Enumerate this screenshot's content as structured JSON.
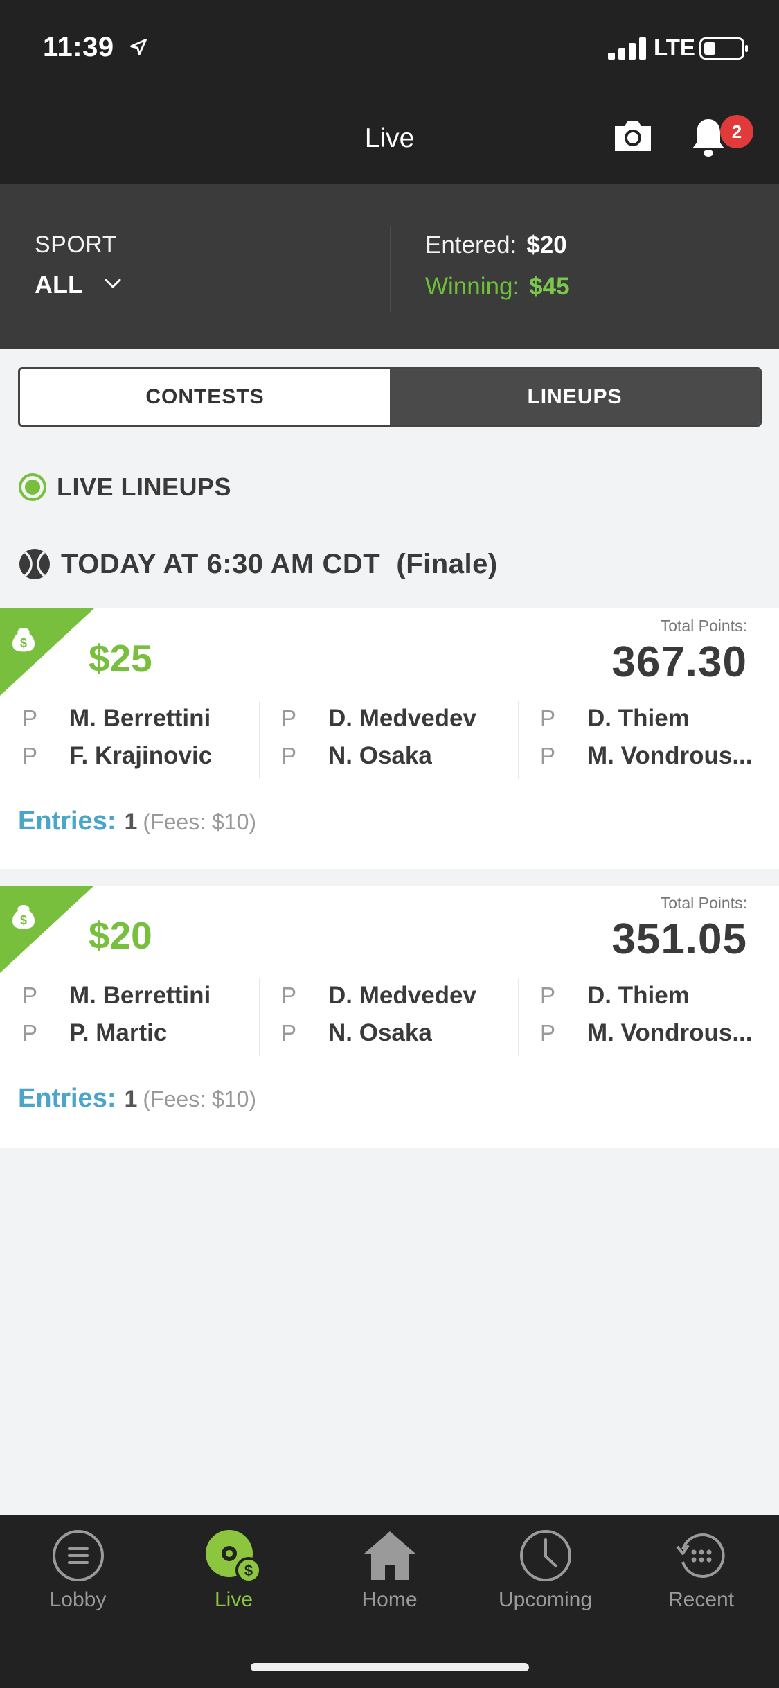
{
  "status_bar": {
    "time": "11:39",
    "network": "LTE",
    "signal_icon": "signal-bars-icon",
    "battery_icon": "battery-icon"
  },
  "nav": {
    "title": "Live",
    "notification_count": "2"
  },
  "summary": {
    "sport_label": "SPORT",
    "sport_value": "ALL",
    "entered_label": "Entered:",
    "entered_value": "$20",
    "winning_label": "Winning:",
    "winning_value": "$45"
  },
  "tabs": {
    "contests": "CONTESTS",
    "lineups": "LINEUPS",
    "selected": "LINEUPS"
  },
  "section": {
    "live_title": "LIVE LINEUPS",
    "date_title": "TODAY AT 6:30 AM CDT  (Finale)"
  },
  "lineups": [
    {
      "prize": "$25",
      "points_label": "Total Points:",
      "points": "367.30",
      "players": [
        [
          {
            "pos": "P",
            "name": "M. Berrettini"
          },
          {
            "pos": "P",
            "name": "F. Krajinovic"
          }
        ],
        [
          {
            "pos": "P",
            "name": "D. Medvedev"
          },
          {
            "pos": "P",
            "name": "N. Osaka"
          }
        ],
        [
          {
            "pos": "P",
            "name": "D. Thiem"
          },
          {
            "pos": "P",
            "name": "M. Vondrous..."
          }
        ]
      ],
      "entries_label": "Entries:",
      "entries_count": "1",
      "fees": "(Fees: $10)"
    },
    {
      "prize": "$20",
      "points_label": "Total Points:",
      "points": "351.05",
      "players": [
        [
          {
            "pos": "P",
            "name": "M. Berrettini"
          },
          {
            "pos": "P",
            "name": "P. Martic"
          }
        ],
        [
          {
            "pos": "P",
            "name": "D. Medvedev"
          },
          {
            "pos": "P",
            "name": "N. Osaka"
          }
        ],
        [
          {
            "pos": "P",
            "name": "D. Thiem"
          },
          {
            "pos": "P",
            "name": "M. Vondrous..."
          }
        ]
      ],
      "entries_label": "Entries:",
      "entries_count": "1",
      "fees": "(Fees: $10)"
    }
  ],
  "tab_bar": [
    {
      "label": "Lobby",
      "icon": "lobby-menu-icon",
      "active": false
    },
    {
      "label": "Live",
      "icon": "live-money-icon",
      "active": true
    },
    {
      "label": "Home",
      "icon": "home-icon",
      "active": false
    },
    {
      "label": "Upcoming",
      "icon": "clock-icon",
      "active": false
    },
    {
      "label": "Recent",
      "icon": "recent-history-icon",
      "active": false
    }
  ],
  "colors": {
    "accent_green": "#77bf3c",
    "entries_blue": "#4aa5c8",
    "badge_red": "#e03a3a",
    "dark_bg": "#222222"
  }
}
